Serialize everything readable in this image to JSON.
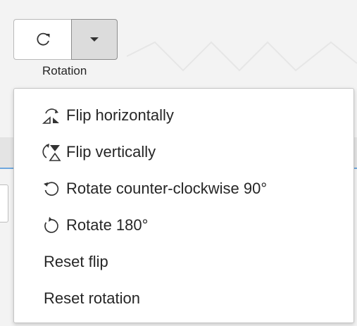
{
  "toolbar": {
    "rotation_group_label": "Rotation",
    "rotate_button_icon": "rotate-clockwise-icon",
    "dropdown_icon": "caret-down-icon"
  },
  "menu": {
    "items": [
      {
        "label": "Flip horizontally",
        "icon": "flip-horizontal-icon"
      },
      {
        "label": "Flip vertically",
        "icon": "flip-vertical-icon"
      },
      {
        "label": "Rotate counter-clockwise 90°",
        "icon": "rotate-counterclockwise-icon"
      },
      {
        "label": "Rotate 180°",
        "icon": "rotate-180-icon"
      },
      {
        "label": "Reset flip",
        "icon": null
      },
      {
        "label": "Reset rotation",
        "icon": null
      }
    ]
  },
  "colors": {
    "accent_line": "#6fa7de",
    "dropdown_bg": "#dcdcdc",
    "menu_bg": "#ffffff"
  }
}
